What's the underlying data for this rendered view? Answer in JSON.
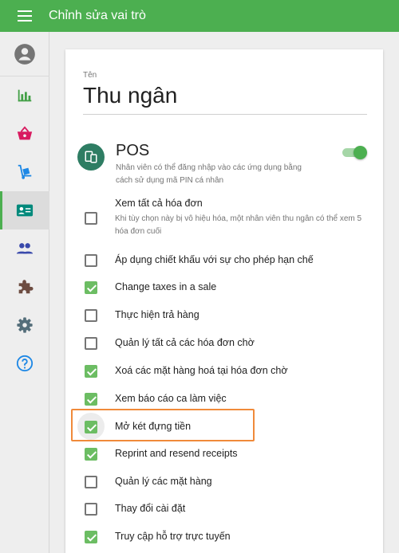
{
  "appbar": {
    "title": "Chỉnh sửa vai trò",
    "menu_icon": "hamburger-menu-icon"
  },
  "sidebar": {
    "items": [
      {
        "name": "account",
        "icon": "account-circle-icon",
        "color": "#757575"
      },
      {
        "name": "reports",
        "icon": "bar-chart-icon",
        "color": "#43a047"
      },
      {
        "name": "items",
        "icon": "basket-icon",
        "color": "#d81b60"
      },
      {
        "name": "inventory",
        "icon": "hand-truck-icon",
        "color": "#1e88e5"
      },
      {
        "name": "employees",
        "icon": "badge-card-icon",
        "color": "#00897b",
        "active": true
      },
      {
        "name": "customers",
        "icon": "people-icon",
        "color": "#3949ab"
      },
      {
        "name": "integrations",
        "icon": "puzzle-icon",
        "color": "#6d4c41"
      },
      {
        "name": "settings",
        "icon": "gear-icon",
        "color": "#546e7a"
      },
      {
        "name": "help",
        "icon": "help-circle-icon",
        "color": "#1e88e5"
      }
    ]
  },
  "form": {
    "name_label": "Tên",
    "name_value": "Thu ngân"
  },
  "pos": {
    "title": "POS",
    "description": "Nhân viên có thể đăng nhập vào các ứng dụng bằng cách sử dụng mã PIN cá nhân",
    "enabled": true,
    "icon": "pos-devices-icon",
    "accent": "#4caf50"
  },
  "permissions": [
    {
      "label": "Xem tất cả hóa đơn",
      "description": "Khi tùy chọn này bị vô hiệu hóa, một nhân viên thu ngân có thể xem 5 hóa đơn cuối",
      "checked": false
    },
    {
      "label": "Áp dụng chiết khấu với sự cho phép hạn chế",
      "checked": false
    },
    {
      "label": "Change taxes in a sale",
      "checked": true
    },
    {
      "label": "Thực hiện trả hàng",
      "checked": false
    },
    {
      "label": "Quản lý tất cả các hóa đơn chờ",
      "checked": false
    },
    {
      "label": "Xoá các mặt hàng hoá tại hóa đơn chờ",
      "checked": true
    },
    {
      "label": "Xem báo cáo ca làm việc",
      "checked": true
    },
    {
      "label": "Mở két đựng tiền",
      "checked": true,
      "highlighted": true
    },
    {
      "label": "Reprint and resend receipts",
      "checked": true
    },
    {
      "label": "Quản lý các mặt hàng",
      "checked": false
    },
    {
      "label": "Thay đổi cài đặt",
      "checked": false
    },
    {
      "label": "Truy cập hỗ trợ trực tuyến",
      "checked": true
    }
  ],
  "colors": {
    "appbar": "#4caf50",
    "checkbox_checked": "#6cbd63",
    "highlight_border": "#f08a3a"
  }
}
